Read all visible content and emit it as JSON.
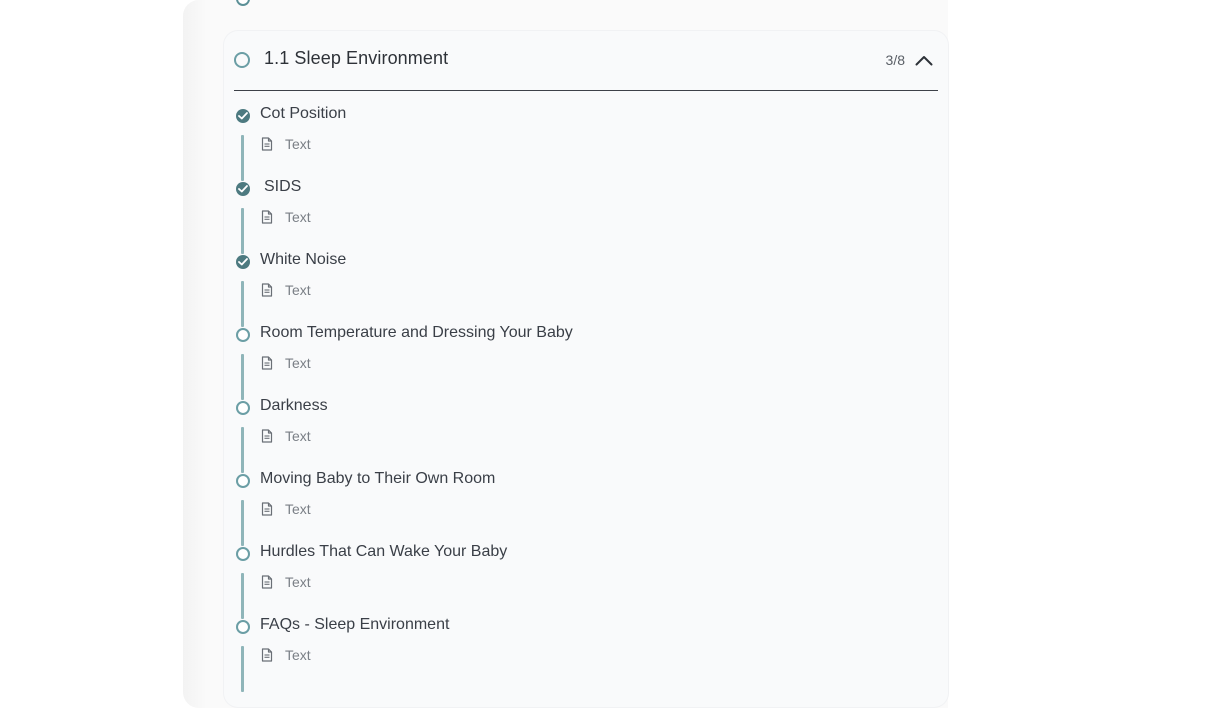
{
  "section": {
    "title": "1.1 Sleep Environment",
    "progress": "3/8",
    "lessons": [
      {
        "title": "Cot Position",
        "type": "Text",
        "completed": true
      },
      {
        "title": "SIDS",
        "type": "Text",
        "completed": true
      },
      {
        "title": "White Noise",
        "type": "Text",
        "completed": true
      },
      {
        "title": "Room Temperature and Dressing Your Baby",
        "type": "Text",
        "completed": false
      },
      {
        "title": "Darkness",
        "type": "Text",
        "completed": false
      },
      {
        "title": "Moving Baby to Their Own Room",
        "type": "Text",
        "completed": false
      },
      {
        "title": "Hurdles That Can Wake Your Baby",
        "type": "Text",
        "completed": false
      },
      {
        "title": "FAQs - Sleep Environment",
        "type": "Text",
        "completed": false
      }
    ]
  },
  "icons": {
    "collapse": "chevron-up-icon",
    "lesson_type": "document-icon",
    "completed": "check-circle-icon",
    "incomplete": "empty-circle-icon"
  },
  "colors": {
    "accent": "#4d7a80",
    "timeline": "#8fb5b9",
    "outline": "#6b9ea5"
  }
}
